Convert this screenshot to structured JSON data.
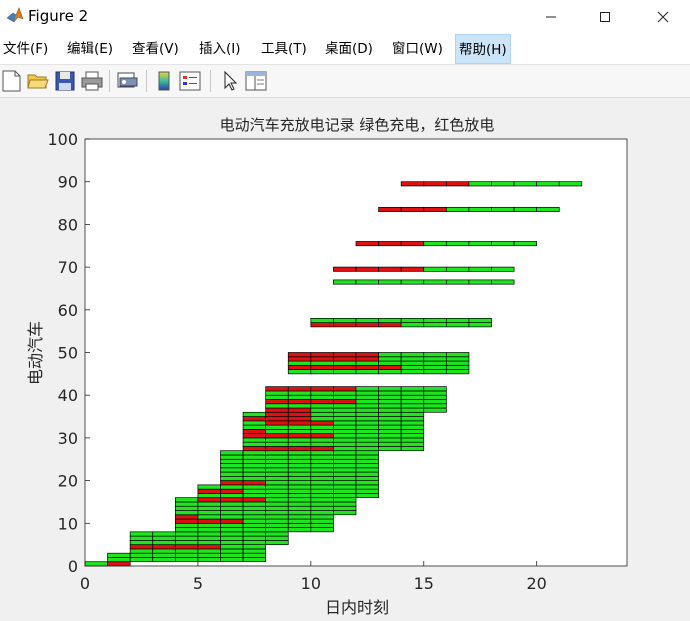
{
  "window": {
    "title": "Figure 2"
  },
  "menu": {
    "items": [
      {
        "label": "文件(F)"
      },
      {
        "label": "编辑(E)"
      },
      {
        "label": "查看(V)"
      },
      {
        "label": "插入(I)"
      },
      {
        "label": "工具(T)"
      },
      {
        "label": "桌面(D)"
      },
      {
        "label": "窗口(W)"
      },
      {
        "label": "帮助(H)"
      }
    ]
  },
  "toolbar": {
    "icons": [
      "new-figure-icon",
      "open-file-icon",
      "save-icon",
      "print-icon",
      "print-preview-icon",
      "colorbar-icon",
      "legend-icon",
      "pointer-icon",
      "property-inspector-icon"
    ]
  },
  "colors": {
    "charge": "#1ee61e",
    "discharge": "#dd1111",
    "edge": "#000000",
    "axes_bg": "#ffffff",
    "figure_bg": "#f0f0f0"
  },
  "chart_data": {
    "type": "bar",
    "title": "电动汽车充放电记录  绿色充电，红色放电",
    "xlabel": "日内时刻",
    "ylabel": "电动汽车",
    "xlim": [
      0,
      24
    ],
    "ylim": [
      0,
      100
    ],
    "xticks": [
      0,
      5,
      10,
      15,
      20
    ],
    "yticks": [
      0,
      10,
      20,
      30,
      40,
      50,
      60,
      70,
      80,
      90,
      100
    ],
    "grid": false,
    "legend": "none",
    "bar_height": 1,
    "vehicle_groups": [
      {
        "from": 1,
        "to": 1,
        "start": 0,
        "end": 2
      },
      {
        "from": 2,
        "to": 3,
        "start": 1,
        "end": 8
      },
      {
        "from": 4,
        "to": 5,
        "start": 2,
        "end": 8
      },
      {
        "from": 6,
        "to": 8,
        "start": 2,
        "end": 9
      },
      {
        "from": 9,
        "to": 12,
        "start": 4,
        "end": 11
      },
      {
        "from": 13,
        "to": 16,
        "start": 4,
        "end": 12
      },
      {
        "from": 17,
        "to": 19,
        "start": 5,
        "end": 13
      },
      {
        "from": 20,
        "to": 27,
        "start": 6,
        "end": 13
      },
      {
        "from": 28,
        "to": 36,
        "start": 7,
        "end": 15
      },
      {
        "from": 37,
        "to": 42,
        "start": 8,
        "end": 16
      },
      {
        "from": 46,
        "to": 50,
        "start": 9,
        "end": 17
      },
      {
        "from": 57,
        "to": 58,
        "start": 10,
        "end": 18
      },
      {
        "from": 67,
        "to": 67,
        "start": 11,
        "end": 19
      },
      {
        "from": 70,
        "to": 70,
        "start": 11,
        "end": 19
      },
      {
        "from": 76,
        "to": 76,
        "start": 12,
        "end": 20
      },
      {
        "from": 84,
        "to": 84,
        "start": 13,
        "end": 21
      },
      {
        "from": 90,
        "to": 90,
        "start": 14,
        "end": 22
      }
    ],
    "discharge_segments": [
      {
        "vehicle": 1,
        "start": 1,
        "end": 2
      },
      {
        "vehicle": 5,
        "start": 2,
        "end": 6
      },
      {
        "vehicle": 11,
        "start": 4,
        "end": 7
      },
      {
        "vehicle": 12,
        "start": 4,
        "end": 5
      },
      {
        "vehicle": 16,
        "start": 5,
        "end": 8
      },
      {
        "vehicle": 18,
        "start": 5,
        "end": 7
      },
      {
        "vehicle": 20,
        "start": 6,
        "end": 8
      },
      {
        "vehicle": 28,
        "start": 7,
        "end": 11
      },
      {
        "vehicle": 31,
        "start": 7,
        "end": 11
      },
      {
        "vehicle": 32,
        "start": 7,
        "end": 8
      },
      {
        "vehicle": 34,
        "start": 8,
        "end": 11
      },
      {
        "vehicle": 35,
        "start": 7,
        "end": 10
      },
      {
        "vehicle": 36,
        "start": 8,
        "end": 10
      },
      {
        "vehicle": 37,
        "start": 8,
        "end": 10
      },
      {
        "vehicle": 39,
        "start": 8,
        "end": 12
      },
      {
        "vehicle": 42,
        "start": 8,
        "end": 12
      },
      {
        "vehicle": 47,
        "start": 9,
        "end": 14
      },
      {
        "vehicle": 49,
        "start": 9,
        "end": 13
      },
      {
        "vehicle": 50,
        "start": 9,
        "end": 13
      },
      {
        "vehicle": 57,
        "start": 10,
        "end": 14
      },
      {
        "vehicle": 70,
        "start": 11,
        "end": 15
      },
      {
        "vehicle": 76,
        "start": 12,
        "end": 15
      },
      {
        "vehicle": 84,
        "start": 13,
        "end": 16
      },
      {
        "vehicle": 90,
        "start": 14,
        "end": 17
      }
    ]
  }
}
